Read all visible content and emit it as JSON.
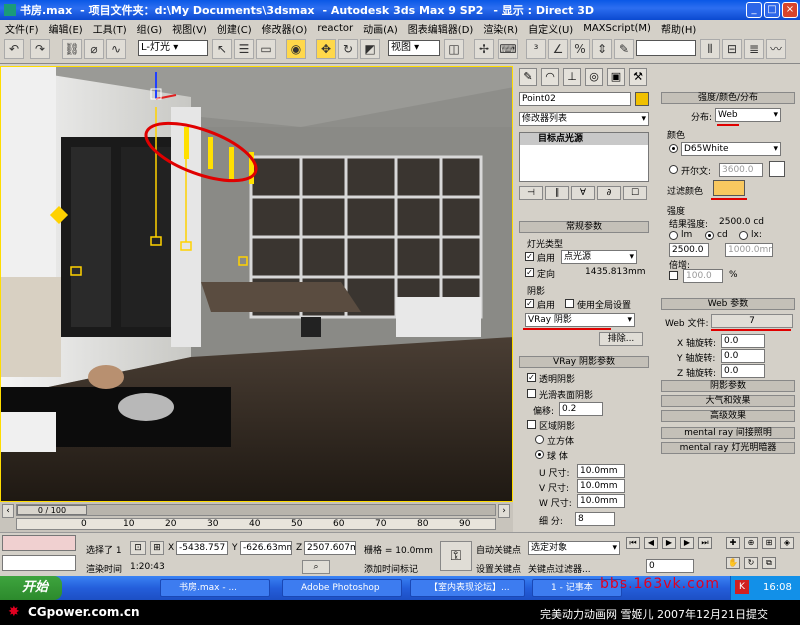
{
  "title": {
    "file": "书房.max",
    "separator": "- 项目文件夹：",
    "path": "d:\\My Documents\\3dsmax",
    "app": "- Autodesk 3ds Max 9 SP2",
    "display": "- 显示 : Direct 3D"
  },
  "menu": [
    "文件(F)",
    "编辑(E)",
    "工具(T)",
    "组(G)",
    "视图(V)",
    "创建(C)",
    "修改器(O)",
    "reactor",
    "动画(A)",
    "图表编辑器(D)",
    "渲染(R)",
    "自定义(U)",
    "MAXScript(M)",
    "帮助(H)"
  ],
  "toolbar": {
    "selection_filter": "L-灯光",
    "ref_coord": "视图"
  },
  "panel": {
    "object_name": "Point02",
    "object_color": "#f0c000",
    "modifier_list": "修改器列表",
    "stack_item": "目标点光源",
    "general": {
      "header": "常规参数",
      "light_type_label": "灯光类型",
      "enabled_label": "启用",
      "light_type": "点光源",
      "targeted_label": "定向",
      "target_distance": "1435.813mm",
      "shadows_label": "阴影",
      "shadow_enabled_label": "启用",
      "global_label": "使用全局设置",
      "shadow_type": "VRay 阴影",
      "exclude_button": "排除..."
    },
    "vray_shadow": {
      "header": "VRay 阴影参数",
      "transparent_label": "透明阴影",
      "smooth_label": "光滑表面阴影",
      "bias_label": "偏移:",
      "bias": "0.2",
      "area_label": "区域阴影",
      "box_label": "立方体",
      "sphere_label": "球 体",
      "u_label": "U 尺寸:",
      "u": "10.0mm",
      "v_label": "V 尺寸:",
      "v": "10.0mm",
      "w_label": "W 尺寸:",
      "w": "10.0mm",
      "subdivs_label": "细  分:",
      "subdivs": "8"
    },
    "intensity": {
      "header": "强度/颜色/分布",
      "distribution_label": "分布:",
      "distribution": "Web",
      "color_label": "颜色",
      "color_preset": "D65White",
      "kelvin_label": "开尔文:",
      "kelvin": "3600.0",
      "filter_label": "过滤颜色",
      "filter_color": "#f8c860",
      "strength_label": "强度",
      "result_label": "结果强度:",
      "result": "2500.0 cd",
      "lm": "lm",
      "cd": "cd",
      "lx": "lx:",
      "value": "2500.0",
      "lx_value": "1000.0mm",
      "multiplier_label": "倍增:",
      "multiplier": "100.0",
      "percent": "%"
    },
    "web": {
      "header": "Web 参数",
      "file_label": "Web 文件:",
      "file": "7",
      "x_label": "X 轴旋转:",
      "x": "0.0",
      "y_label": "Y 轴旋转:",
      "y": "0.0",
      "z_label": "Z 轴旋转:",
      "z": "0.0"
    },
    "rollouts": [
      "阴影参数",
      "大气和效果",
      "高级效果",
      "mental ray 间接照明",
      "mental ray 灯光明暗器"
    ]
  },
  "timeline": {
    "frame": "0 / 100",
    "ticks": [
      "0",
      "10",
      "20",
      "30",
      "40",
      "50",
      "60",
      "70",
      "80",
      "90",
      "100"
    ]
  },
  "status": {
    "selected": "选择了 1",
    "x_label": "X",
    "x": "-5438.757",
    "y_label": "Y",
    "y": "-626.63mm",
    "z_label": "Z",
    "z": "2507.607m",
    "grid": "栅格 = 10.0mm",
    "auto_key": "自动关键点",
    "selected_object": "选定对象",
    "render_time_label": "渲染时间",
    "render_time": "1:20:43",
    "add_tag": "添加时间标记",
    "set_key": "设置关键点",
    "key_filters": "关键点过滤器...",
    "frame_field": "0"
  },
  "taskbar": {
    "start": "开始",
    "tasks": [
      "书房.max - ...",
      "Adobe Photoshop",
      "【室内表现论坛】...",
      "1 - 记事本"
    ],
    "clock": "16:08"
  },
  "watermarks": {
    "site": "bbs.163vk.com",
    "cgpower": "CGpower.com.cn",
    "credit": "完美动力动画网 雪姬儿 2007年12月21日提交"
  }
}
